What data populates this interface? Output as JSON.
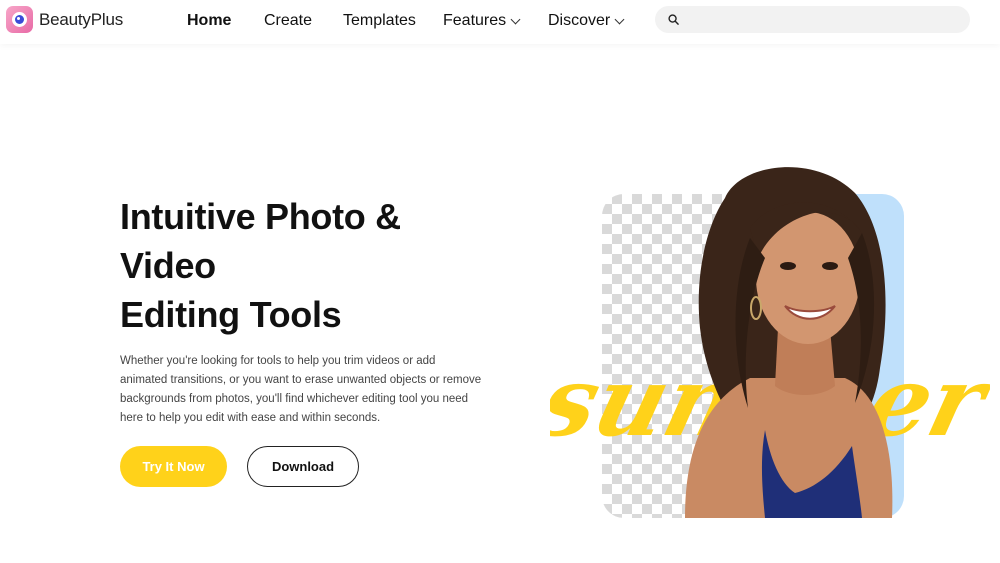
{
  "brand": {
    "name": "BeautyPlus"
  },
  "nav": {
    "items": [
      {
        "label": "Home",
        "active": true,
        "dropdown": false
      },
      {
        "label": "Create",
        "active": false,
        "dropdown": false
      },
      {
        "label": "Templates",
        "active": false,
        "dropdown": false
      },
      {
        "label": "Features",
        "active": false,
        "dropdown": true
      },
      {
        "label": "Discover",
        "active": false,
        "dropdown": true
      }
    ]
  },
  "search": {
    "placeholder": ""
  },
  "hero": {
    "title_lines": [
      "Intuitive Photo &",
      "Video",
      "Editing Tools"
    ],
    "description": "Whether you're looking for tools to help you trim videos or add animated transitions, or you want to erase unwanted objects or remove backgrounds from photos, you'll find whichever editing tool you need here to help you edit with ease and within seconds.",
    "primary_button": "Try It Now",
    "secondary_button": "Download"
  },
  "visual": {
    "script_text": "summer"
  },
  "colors": {
    "accent_yellow": "#ffd21a",
    "panel_blue": "#bfe0fb",
    "text_dark": "#111111",
    "logo_pink": "#e86aa6"
  }
}
